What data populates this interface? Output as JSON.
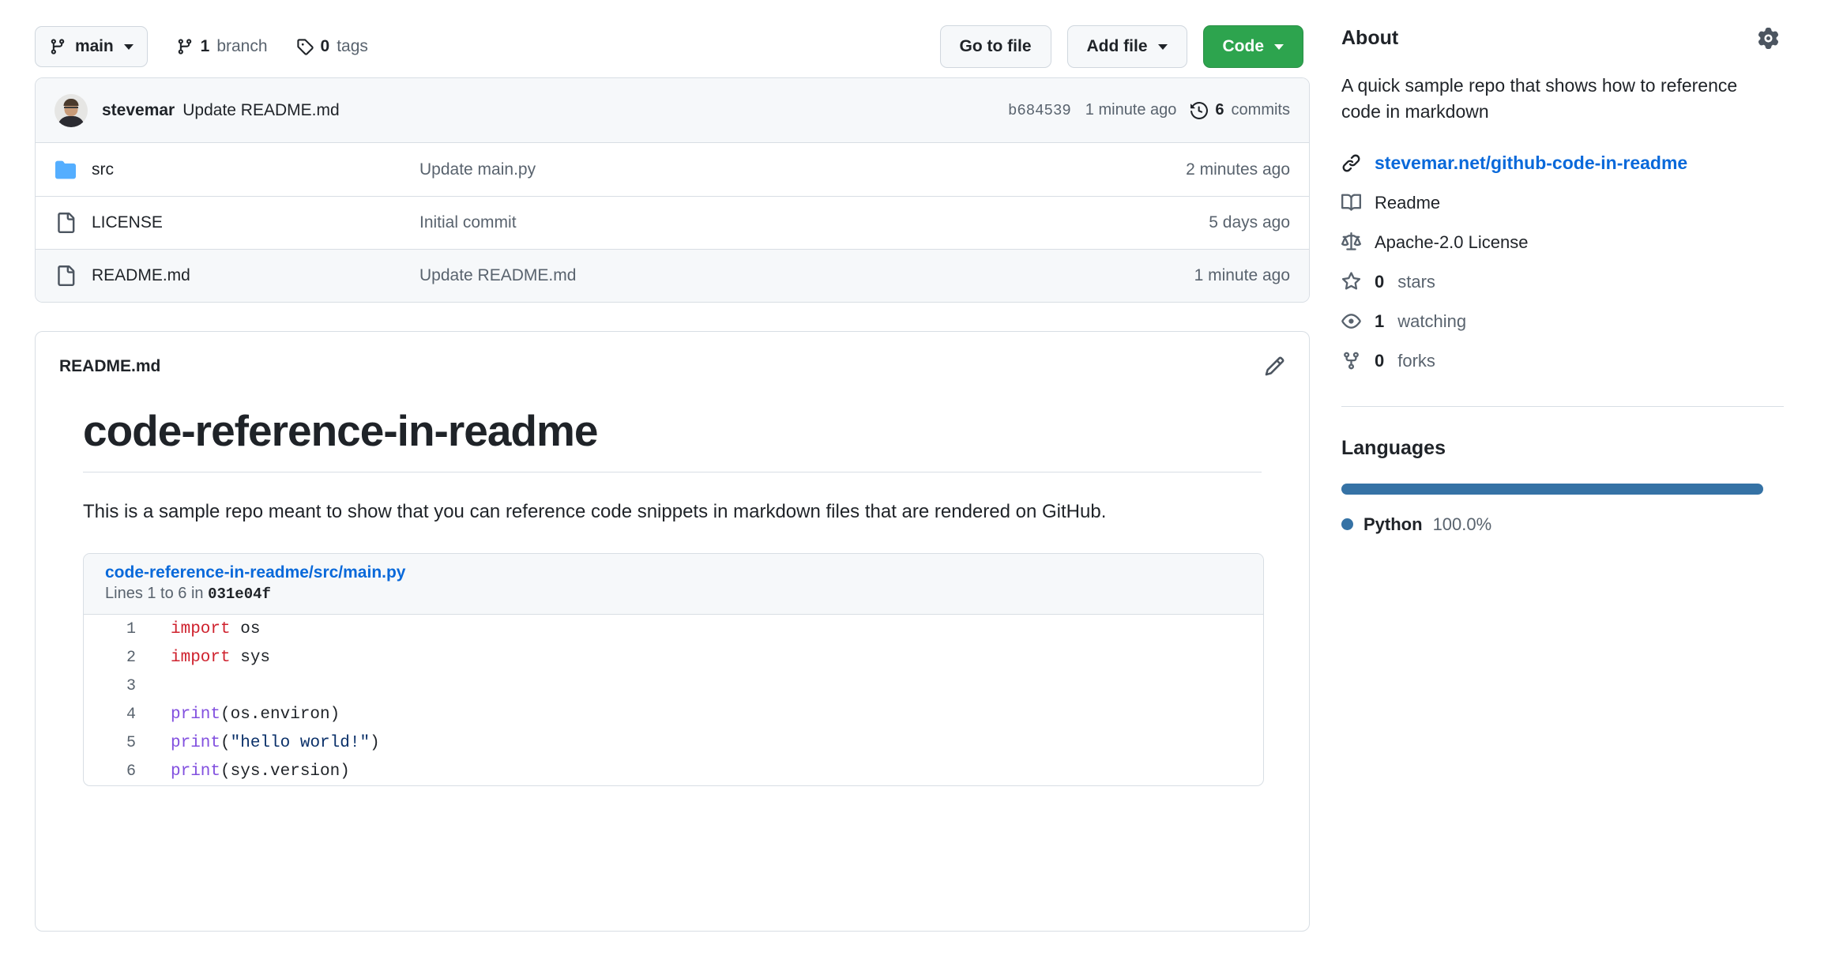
{
  "toolbar": {
    "branch_name": "main",
    "branch_count_num": "1",
    "branch_count_label": "branch",
    "tag_count_num": "0",
    "tag_count_label": "tags",
    "go_to_file": "Go to file",
    "add_file": "Add file",
    "code": "Code"
  },
  "commit_bar": {
    "author": "stevemar",
    "message": "Update README.md",
    "sha": "b684539",
    "time": "1 minute ago",
    "commits_num": "6",
    "commits_label": "commits"
  },
  "files": [
    {
      "icon": "folder-icon",
      "name": "src",
      "message": "Update main.py",
      "time": "2 minutes ago"
    },
    {
      "icon": "file-icon",
      "name": "LICENSE",
      "message": "Initial commit",
      "time": "5 days ago"
    },
    {
      "icon": "file-icon",
      "name": "README.md",
      "message": "Update README.md",
      "time": "1 minute ago"
    }
  ],
  "readme": {
    "filename": "README.md",
    "heading": "code-reference-in-readme",
    "paragraph": "This is a sample repo meant to show that you can reference code snippets in markdown files that are rendered on GitHub.",
    "snippet": {
      "path": "code-reference-in-readme/src/main.py",
      "lines_prefix": "Lines 1 to 6 in ",
      "commit": "031e04f",
      "code_lines": [
        {
          "no": "1",
          "tokens": [
            {
              "t": "import",
              "c": "tok-kw"
            },
            {
              "t": " os",
              "c": ""
            }
          ]
        },
        {
          "no": "2",
          "tokens": [
            {
              "t": "import",
              "c": "tok-kw"
            },
            {
              "t": " sys",
              "c": ""
            }
          ]
        },
        {
          "no": "3",
          "tokens": []
        },
        {
          "no": "4",
          "tokens": [
            {
              "t": "print",
              "c": "tok-fn"
            },
            {
              "t": "(os.environ)",
              "c": ""
            }
          ]
        },
        {
          "no": "5",
          "tokens": [
            {
              "t": "print",
              "c": "tok-fn"
            },
            {
              "t": "(",
              "c": ""
            },
            {
              "t": "\"hello world!\"",
              "c": "tok-str"
            },
            {
              "t": ")",
              "c": ""
            }
          ]
        },
        {
          "no": "6",
          "tokens": [
            {
              "t": "print",
              "c": "tok-fn"
            },
            {
              "t": "(sys.version)",
              "c": ""
            }
          ]
        }
      ]
    }
  },
  "about": {
    "title": "About",
    "description": "A quick sample repo that shows how to reference code in markdown",
    "website": "stevemar.net/github-code-in-readme",
    "readme_label": "Readme",
    "license_label": "Apache-2.0 License",
    "stars_num": "0",
    "stars_label": "stars",
    "watching_num": "1",
    "watching_label": "watching",
    "forks_num": "0",
    "forks_label": "forks"
  },
  "languages": {
    "title": "Languages",
    "items": [
      {
        "name": "Python",
        "percent": "100.0%",
        "color": "#3572A5",
        "width": "100%"
      }
    ]
  },
  "colors": {
    "accent_green": "#2da44e",
    "link_blue": "#0969da",
    "folder_blue": "#54aeff",
    "border": "#d8dee4",
    "muted_text": "#59636e",
    "python": "#3572A5"
  }
}
